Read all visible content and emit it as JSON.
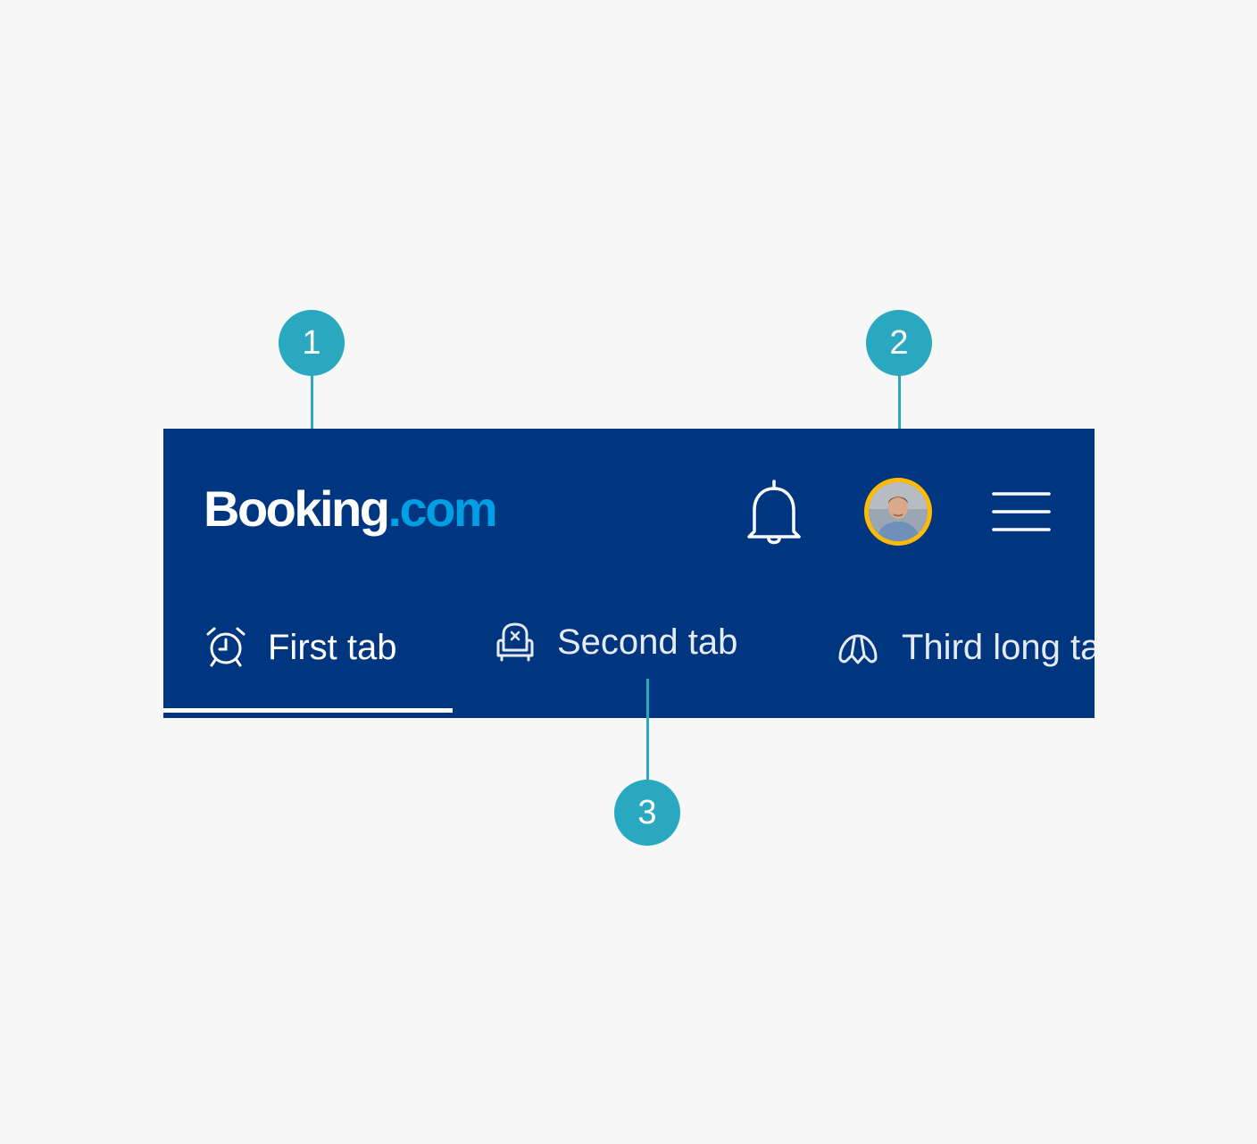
{
  "header": {
    "logo": {
      "main": "Booking",
      "suffix": ".com"
    },
    "notifications_icon": "bell-icon",
    "avatar_icon": "user-avatar",
    "menu_icon": "hamburger-menu-icon"
  },
  "tabs": [
    {
      "label": "First tab",
      "icon": "alarm-clock-icon",
      "selected": true
    },
    {
      "label": "Second tab",
      "icon": "armchair-icon",
      "selected": false
    },
    {
      "label": "Third long tab",
      "icon": "croissant-icon",
      "selected": false
    }
  ],
  "callouts": [
    "1",
    "2",
    "3"
  ],
  "colors": {
    "background": "#f7f7f7",
    "header_bg": "#003580",
    "logo_accent": "#009fe3",
    "avatar_ring": "#febb02",
    "callout": "#2aa8c0"
  }
}
